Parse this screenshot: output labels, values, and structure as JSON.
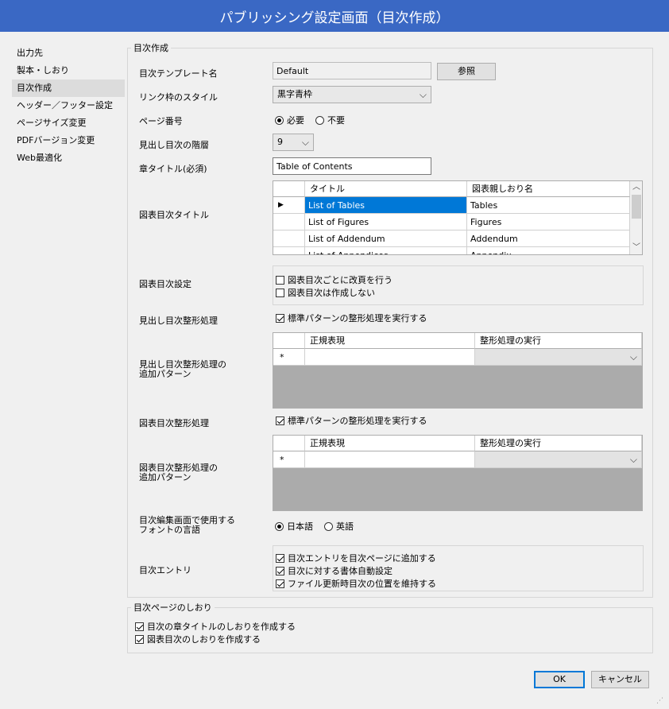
{
  "window": {
    "title": "パブリッシング設定画面（目次作成）"
  },
  "sidebar": {
    "items": [
      {
        "label": "出力先"
      },
      {
        "label": "製本・しおり"
      },
      {
        "label": "目次作成"
      },
      {
        "label": "ヘッダー／フッター設定"
      },
      {
        "label": "ページサイズ変更"
      },
      {
        "label": "PDFバージョン変更"
      },
      {
        "label": "Web最適化"
      }
    ],
    "selected_index": 2
  },
  "toc_group": {
    "legend": "目次作成",
    "template": {
      "label": "目次テンプレート名",
      "value": "Default",
      "browse_label": "参照"
    },
    "link_frame": {
      "label": "リンク枠のスタイル",
      "value": "黒字青枠"
    },
    "page_number": {
      "label": "ページ番号",
      "options": [
        "必要",
        "不要"
      ],
      "selected": "必要"
    },
    "heading_level": {
      "label": "見出し目次の階層",
      "value": "9"
    },
    "chapter_title": {
      "label": "章タイトル(必須)",
      "value": "Table of Contents"
    },
    "figure_toc_title": {
      "label": "図表目次タイトル",
      "columns": [
        "タイトル",
        "図表親しおり名"
      ],
      "rows": [
        [
          "List of Tables",
          "Tables"
        ],
        [
          "List of Figures",
          "Figures"
        ],
        [
          "List of Addendum",
          "Addendum"
        ],
        [
          "List of Appendices",
          "Appendix"
        ]
      ],
      "selected_row": 0
    },
    "figure_toc_settings": {
      "label": "図表目次設定",
      "options": [
        {
          "label": "図表目次ごとに改頁を行う",
          "checked": false
        },
        {
          "label": "図表目次は作成しない",
          "checked": false
        }
      ]
    },
    "heading_format": {
      "label": "見出し目次整形処理",
      "checkbox_label": "標準パターンの整形処理を実行する",
      "checked": true
    },
    "heading_patterns": {
      "label_line1": "見出し目次整形処理の",
      "label_line2": "追加パターン",
      "columns": [
        "正規表現",
        "整形処理の実行"
      ],
      "new_row_marker": "*"
    },
    "figure_format": {
      "label": "図表目次整形処理",
      "checkbox_label": "標準パターンの整形処理を実行する",
      "checked": true
    },
    "figure_patterns": {
      "label_line1": "図表目次整形処理の",
      "label_line2": "追加パターン",
      "columns": [
        "正規表現",
        "整形処理の実行"
      ],
      "new_row_marker": "*"
    },
    "font_language": {
      "label_line1": "目次編集画面で使用する",
      "label_line2": "フォントの言語",
      "options": [
        "日本語",
        "英語"
      ],
      "selected": "日本語"
    },
    "toc_entry": {
      "label": "目次エントリ",
      "options": [
        {
          "label": "目次エントリを目次ページに追加する",
          "checked": true
        },
        {
          "label": "目次に対する書体自動設定",
          "checked": true
        },
        {
          "label": "ファイル更新時目次の位置を維持する",
          "checked": true
        }
      ]
    }
  },
  "bookmark_group": {
    "legend": "目次ページのしおり",
    "options": [
      {
        "label": "目次の章タイトルのしおりを作成する",
        "checked": true
      },
      {
        "label": "図表目次のしおりを作成する",
        "checked": true
      }
    ]
  },
  "footer": {
    "ok_label": "OK",
    "cancel_label": "キャンセル"
  },
  "colors": {
    "title_bar": "#3a68c4",
    "selection": "#0078d7",
    "grid_empty": "#ababab"
  },
  "icons": [
    "chevron-down-icon",
    "radio-icon",
    "checkbox-icon",
    "row-pointer-icon",
    "scroll-up-icon",
    "scroll-down-icon",
    "resize-grip-icon"
  ]
}
